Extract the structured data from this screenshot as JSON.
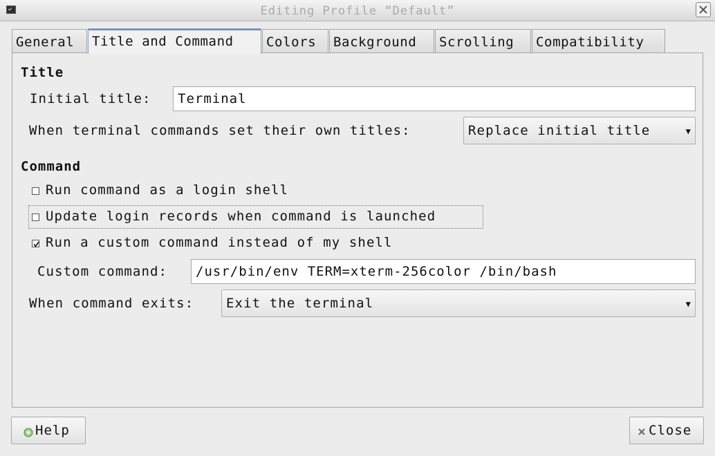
{
  "window": {
    "title": "Editing Profile “Default”",
    "icons": {
      "app": "terminal-icon",
      "close": "close-icon"
    }
  },
  "tabs": [
    {
      "label": "General",
      "active": false
    },
    {
      "label": "Title and Command",
      "active": true
    },
    {
      "label": "Colors",
      "active": false
    },
    {
      "label": "Background",
      "active": false
    },
    {
      "label": "Scrolling",
      "active": false
    },
    {
      "label": "Compatibility",
      "active": false
    }
  ],
  "title_section": {
    "heading": "Title",
    "initial_title_label": "Initial title:",
    "initial_title_value": "Terminal",
    "dynamic_title_label": "When terminal commands set their own titles:",
    "dynamic_title_value": "Replace initial title"
  },
  "command_section": {
    "heading": "Command",
    "login_shell": {
      "label": "Run command as a login shell",
      "checked": false
    },
    "update_records": {
      "label": "Update login records when command is launched",
      "checked": false
    },
    "custom_command_toggle": {
      "label": "Run a custom command instead of my shell",
      "checked": true
    },
    "custom_command_label": "Custom command:",
    "custom_command_value": "/usr/bin/env TERM=xterm-256color /bin/bash",
    "exit_action_label": "When command exits:",
    "exit_action_value": "Exit the terminal"
  },
  "buttons": {
    "help": {
      "label": "Help",
      "icon": "help-icon"
    },
    "close": {
      "label": "Close",
      "icon": "close-icon"
    }
  }
}
